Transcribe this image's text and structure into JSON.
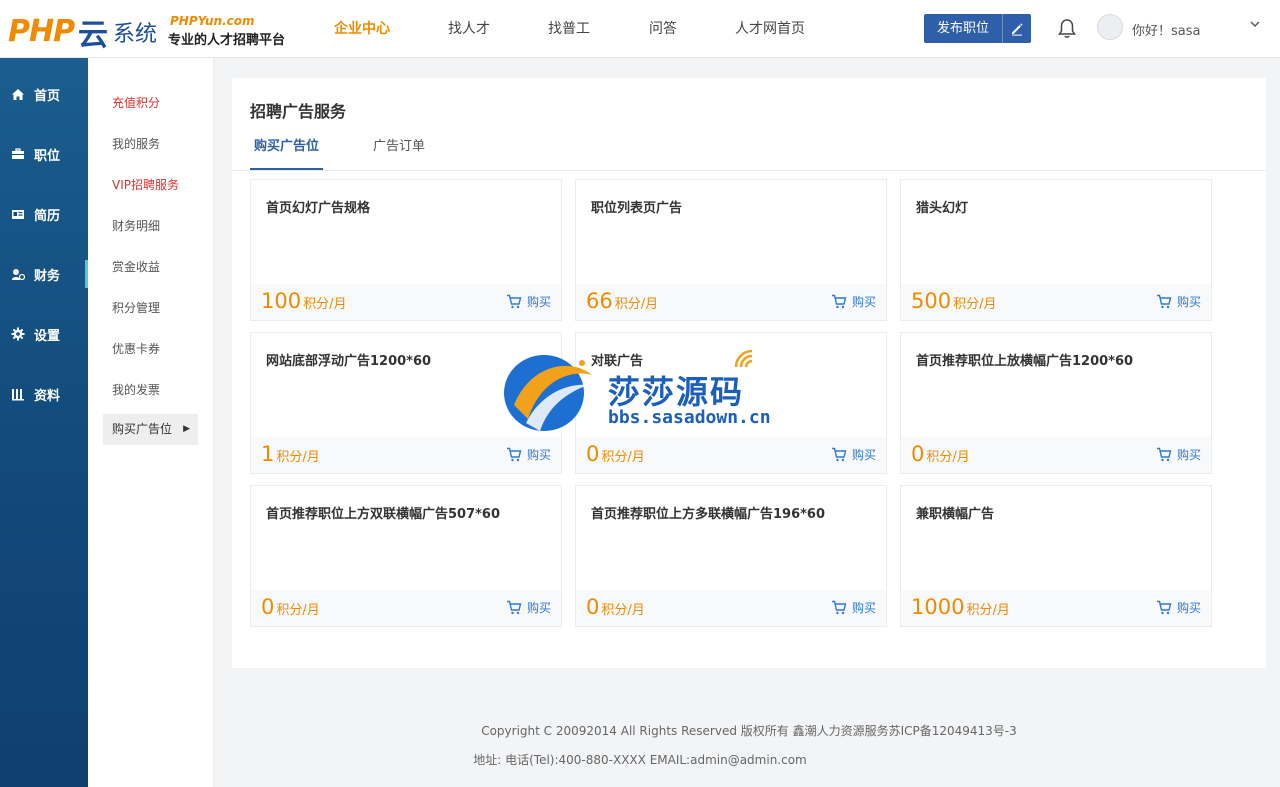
{
  "header": {
    "logo": {
      "php": "PHP",
      "yun": "云",
      "system": "系统",
      "site": "PHPYun.com",
      "slogan": "专业的人才招聘平台"
    },
    "nav": [
      {
        "label": "企业中心",
        "active": true
      },
      {
        "label": "找人才",
        "active": false
      },
      {
        "label": "找普工",
        "active": false
      },
      {
        "label": "问答",
        "active": false
      },
      {
        "label": "人才网首页",
        "active": false
      }
    ],
    "post_button": "发布职位",
    "greeting": "你好！sasa"
  },
  "sidebar": {
    "items": [
      {
        "label": "首页",
        "icon": "home-icon"
      },
      {
        "label": "职位",
        "icon": "briefcase-icon"
      },
      {
        "label": "简历",
        "icon": "id-card-icon"
      },
      {
        "label": "财务",
        "icon": "finance-icon",
        "active": true
      },
      {
        "label": "设置",
        "icon": "gear-icon"
      },
      {
        "label": "资料",
        "icon": "document-icon"
      }
    ]
  },
  "subsidebar": {
    "items": [
      {
        "label": "充值积分",
        "style": "red"
      },
      {
        "label": "我的服务"
      },
      {
        "label": "VIP招聘服务",
        "style": "red"
      },
      {
        "label": "财务明细"
      },
      {
        "label": "赏金收益"
      },
      {
        "label": "积分管理"
      },
      {
        "label": "优惠卡券"
      },
      {
        "label": "我的发票"
      },
      {
        "label": "购买广告位",
        "active": true
      }
    ]
  },
  "main": {
    "title": "招聘广告服务",
    "tabs": [
      {
        "label": "购买广告位",
        "active": true
      },
      {
        "label": "广告订单",
        "active": false
      }
    ],
    "unit": "积分/月",
    "buy_label": "购买",
    "cards": [
      {
        "title": "首页幻灯广告规格",
        "price": "100"
      },
      {
        "title": "职位列表页广告",
        "price": "66"
      },
      {
        "title": "猎头幻灯",
        "price": "500"
      },
      {
        "title": "网站底部浮动广告1200*60",
        "price": "1"
      },
      {
        "title": "对联广告",
        "price": "0"
      },
      {
        "title": "首页推荐职位上放横幅广告1200*60",
        "price": "0"
      },
      {
        "title": "首页推荐职位上方双联横幅广告507*60",
        "price": "0"
      },
      {
        "title": "首页推荐职位上方多联横幅广告196*60",
        "price": "0"
      },
      {
        "title": "兼职横幅广告",
        "price": "1000"
      }
    ]
  },
  "watermark": {
    "name": "莎莎源码",
    "url": "bbs.sasadown.cn"
  },
  "footer": {
    "copyright": "Copyright C 20092014 All Rights Reserved 版权所有 鑫潮人力资源服务苏ICP备12049413号-3",
    "contact": "地址: 电话(Tel):400-880-XXXX EMAIL:admin@admin.com"
  },
  "colors": {
    "accent_orange": "#f08a00",
    "primary_blue": "#2f5fa8",
    "sidebar_bg": "#124a7b",
    "link_blue": "#2f7ad0",
    "red": "#d9332f"
  }
}
